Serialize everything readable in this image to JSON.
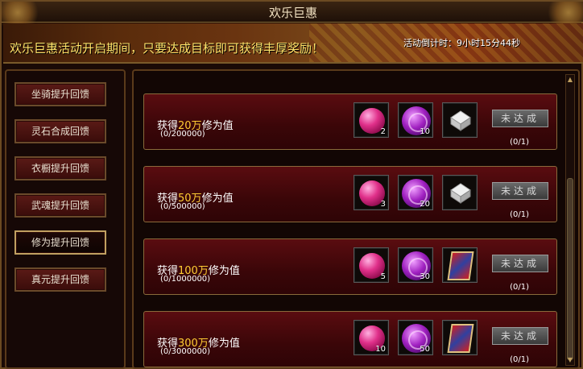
{
  "window": {
    "title": "欢乐巨惠"
  },
  "banner": {
    "text": "欢乐巨惠活动开启期间，只要达成目标即可获得丰厚奖励！",
    "countdown": "活动倒计时：9小时15分44秒"
  },
  "sidebar": {
    "items": [
      {
        "label": "坐骑提升回馈",
        "active": false
      },
      {
        "label": "灵石合成回馈",
        "active": false
      },
      {
        "label": "衣橱提升回馈",
        "active": false
      },
      {
        "label": "武魂提升回馈",
        "active": false
      },
      {
        "label": "修为提升回馈",
        "active": true
      },
      {
        "label": "真元提升回馈",
        "active": false
      }
    ]
  },
  "rewards": [
    {
      "prefix": "获得",
      "amount": "20万",
      "suffix": "修为值",
      "progress": "(0/200000)",
      "items": [
        {
          "icon": "pink-gem-icon",
          "count": "2"
        },
        {
          "icon": "purple-orb-icon",
          "count": "10"
        },
        {
          "icon": "silver-ingot-icon",
          "count": ""
        }
      ],
      "status": "未达成",
      "ratio": "(0/1)"
    },
    {
      "prefix": "获得",
      "amount": "50万",
      "suffix": "修为值",
      "progress": "(0/500000)",
      "items": [
        {
          "icon": "pink-gem-icon",
          "count": "3"
        },
        {
          "icon": "purple-orb-icon",
          "count": "20"
        },
        {
          "icon": "silver-ingot-icon",
          "count": ""
        }
      ],
      "status": "未达成",
      "ratio": "(0/1)"
    },
    {
      "prefix": "获得",
      "amount": "100万",
      "suffix": "修为值",
      "progress": "(0/1000000)",
      "items": [
        {
          "icon": "pink-gem-icon",
          "count": "5"
        },
        {
          "icon": "purple-orb-icon",
          "count": "30"
        },
        {
          "icon": "scroll-icon",
          "count": ""
        }
      ],
      "status": "未达成",
      "ratio": "(0/1)"
    },
    {
      "prefix": "获得",
      "amount": "300万",
      "suffix": "修为值",
      "progress": "(0/3000000)",
      "items": [
        {
          "icon": "pink-gem-icon",
          "count": "10"
        },
        {
          "icon": "purple-orb-icon",
          "count": "50"
        },
        {
          "icon": "scroll-icon",
          "count": ""
        }
      ],
      "status": "未达成",
      "ratio": "(0/1)"
    }
  ]
}
